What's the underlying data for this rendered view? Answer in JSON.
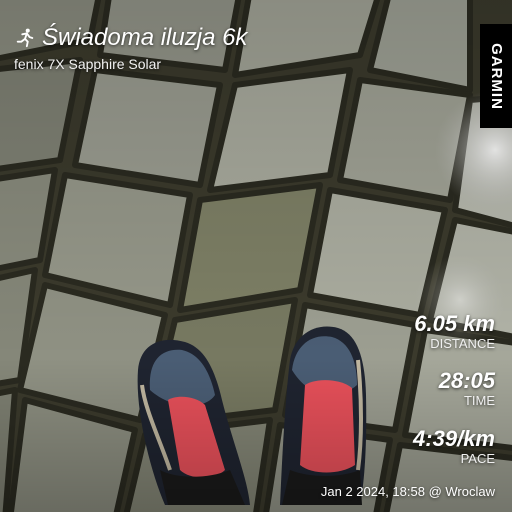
{
  "activity": {
    "title": "Świadoma iluzja 6k",
    "device": "fenix 7X Sapphire Solar",
    "sport_icon": "running-icon"
  },
  "brand": {
    "name": "GARMIN"
  },
  "stats": {
    "distance": {
      "value": "6.05 km",
      "label": "DISTANCE"
    },
    "time": {
      "value": "28:05",
      "label": "TIME"
    },
    "pace": {
      "value": "4:39/km",
      "label": "PACE"
    }
  },
  "footer": {
    "datetime_location": "Jan 2 2024, 18:58 @ Wroclaw"
  }
}
